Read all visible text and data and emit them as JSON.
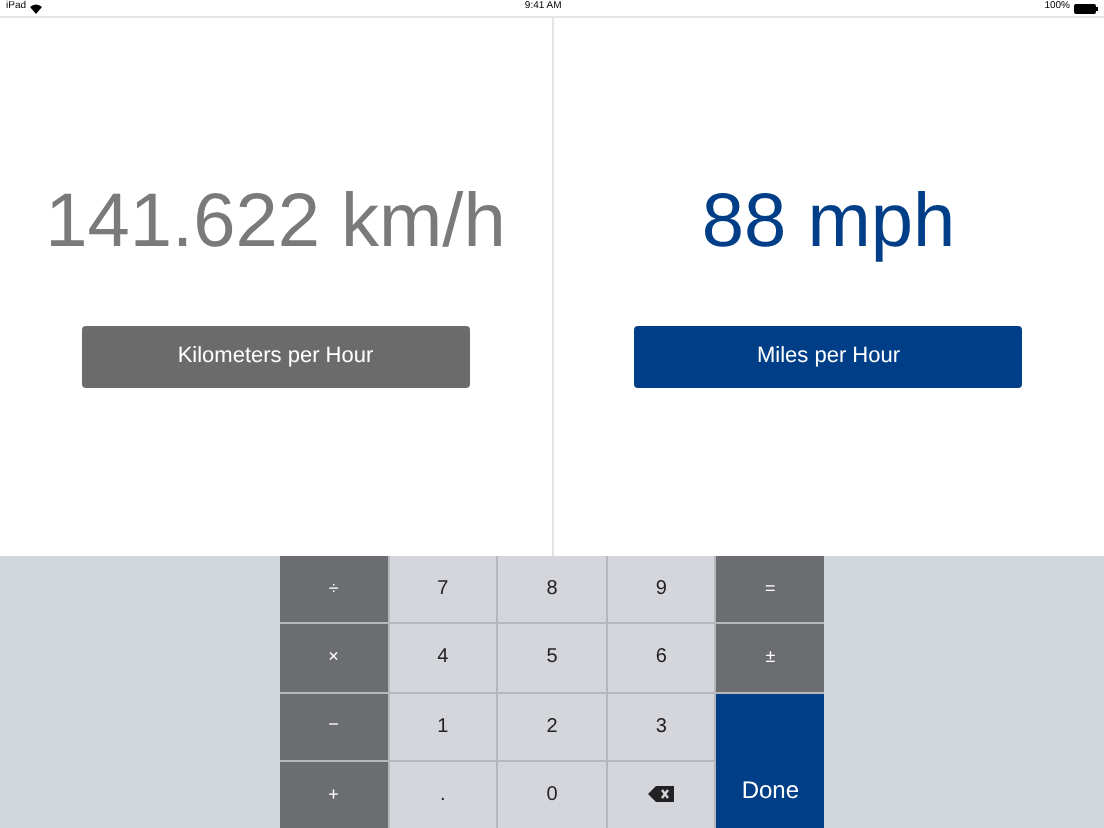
{
  "status_bar": {
    "device": "iPad",
    "time": "9:41 AM",
    "battery": "100%"
  },
  "panels": [
    {
      "value": "141.622 km/h",
      "unit_button": "Kilometers per Hour",
      "selected": false
    },
    {
      "value": "88 mph",
      "unit_button": "Miles per Hour",
      "selected": true
    }
  ],
  "keypad": [
    {
      "kind": "operator",
      "label": "÷"
    },
    {
      "kind": "digit",
      "label": "7"
    },
    {
      "kind": "digit",
      "label": "8"
    },
    {
      "kind": "digit",
      "label": "9"
    },
    {
      "kind": "operator",
      "label": "="
    },
    {
      "kind": "operator",
      "label": "×"
    },
    {
      "kind": "digit",
      "label": "4"
    },
    {
      "kind": "digit",
      "label": "5"
    },
    {
      "kind": "digit",
      "label": "6"
    },
    {
      "kind": "operator",
      "label": "±"
    },
    {
      "kind": "operator",
      "label": "−"
    },
    {
      "kind": "digit",
      "label": "1"
    },
    {
      "kind": "digit",
      "label": "2"
    },
    {
      "kind": "digit",
      "label": "3"
    },
    {
      "kind": "operator",
      "label": "+"
    },
    {
      "kind": "digit",
      "label": "."
    },
    {
      "kind": "digit",
      "label": "0"
    },
    {
      "kind": "backspace"
    },
    {
      "kind": "done",
      "label": "Done"
    }
  ]
}
